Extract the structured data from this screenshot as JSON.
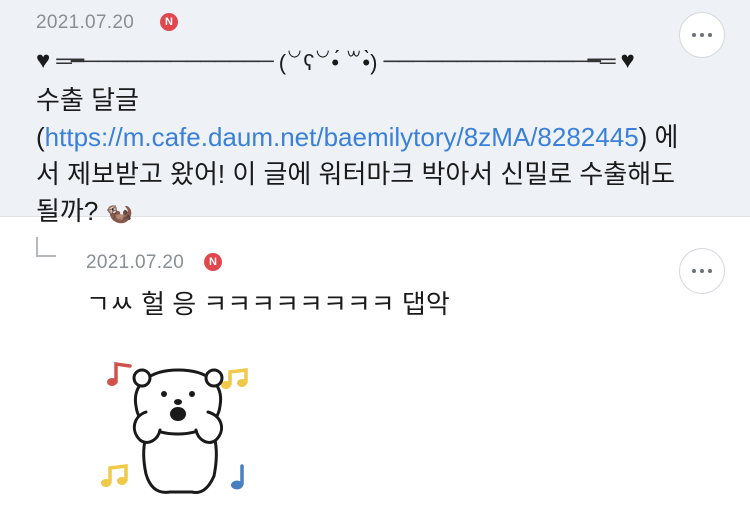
{
  "comment": {
    "date": "2021.07.20",
    "badge": "N",
    "deco": {
      "heart_left": "♥",
      "line_left": "═━─────────────",
      "face": "(꒡ʕ꒡•́ ꒳•̀)",
      "line_right": "──────────────━═",
      "heart_right": "♥"
    },
    "text_1": "수출 달글 (",
    "link": "https://m.cafe.daum.net/baemilytory/8zMA/8282445",
    "text_2": ") 에서 제보받고 왔어! 이 글에 워터마크 박아서 신밀로 수출해도 될까?",
    "emoji": "🦦"
  },
  "reply": {
    "date": "2021.07.20",
    "badge": "N",
    "text": "ㄱㅆ 헐 응 ㅋㅋㅋㅋㅋㅋㅋㅋ 댑악"
  },
  "colors": {
    "comment_bg": "#eef2f7",
    "link": "#3a80d9",
    "badge": "#e0484e",
    "note_red": "#d0524c",
    "note_yellow": "#f0c94a",
    "note_blue": "#4a7fc0"
  }
}
